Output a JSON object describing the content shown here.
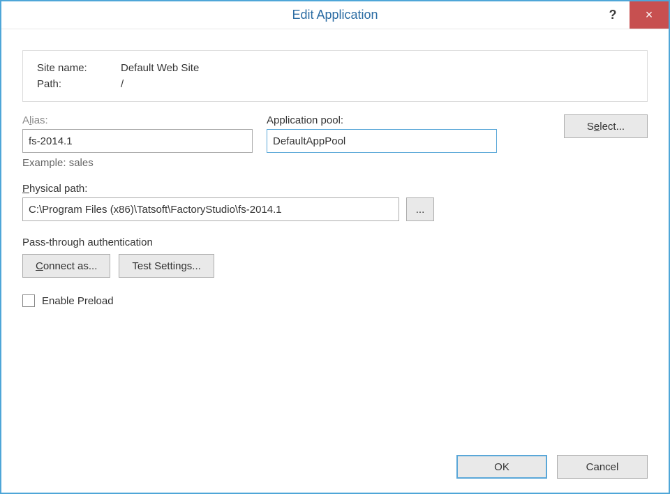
{
  "titlebar": {
    "title": "Edit Application",
    "help_label": "?",
    "close_label": "×"
  },
  "info": {
    "site_name_label": "Site name:",
    "site_name_value": "Default Web Site",
    "path_label": "Path:",
    "path_value": "/"
  },
  "alias": {
    "label_pre": "A",
    "label_accel": "l",
    "label_post": "ias:",
    "value": "fs-2014.1",
    "example_label": "Example: sales"
  },
  "app_pool": {
    "label": "Application pool:",
    "value": "DefaultAppPool",
    "select_pre": "S",
    "select_accel": "e",
    "select_post": "lect..."
  },
  "physical_path": {
    "label_accel": "P",
    "label_post": "hysical path:",
    "value": "C:\\Program Files (x86)\\Tatsoft\\FactoryStudio\\fs-2014.1",
    "browse_label": "..."
  },
  "auth": {
    "section_label": "Pass-through authentication",
    "connect_accel": "C",
    "connect_post": "onnect as...",
    "test_label": "Test Settings..."
  },
  "preload": {
    "label": "Enable Preload",
    "checked": false
  },
  "footer": {
    "ok_label": "OK",
    "cancel_label": "Cancel"
  }
}
